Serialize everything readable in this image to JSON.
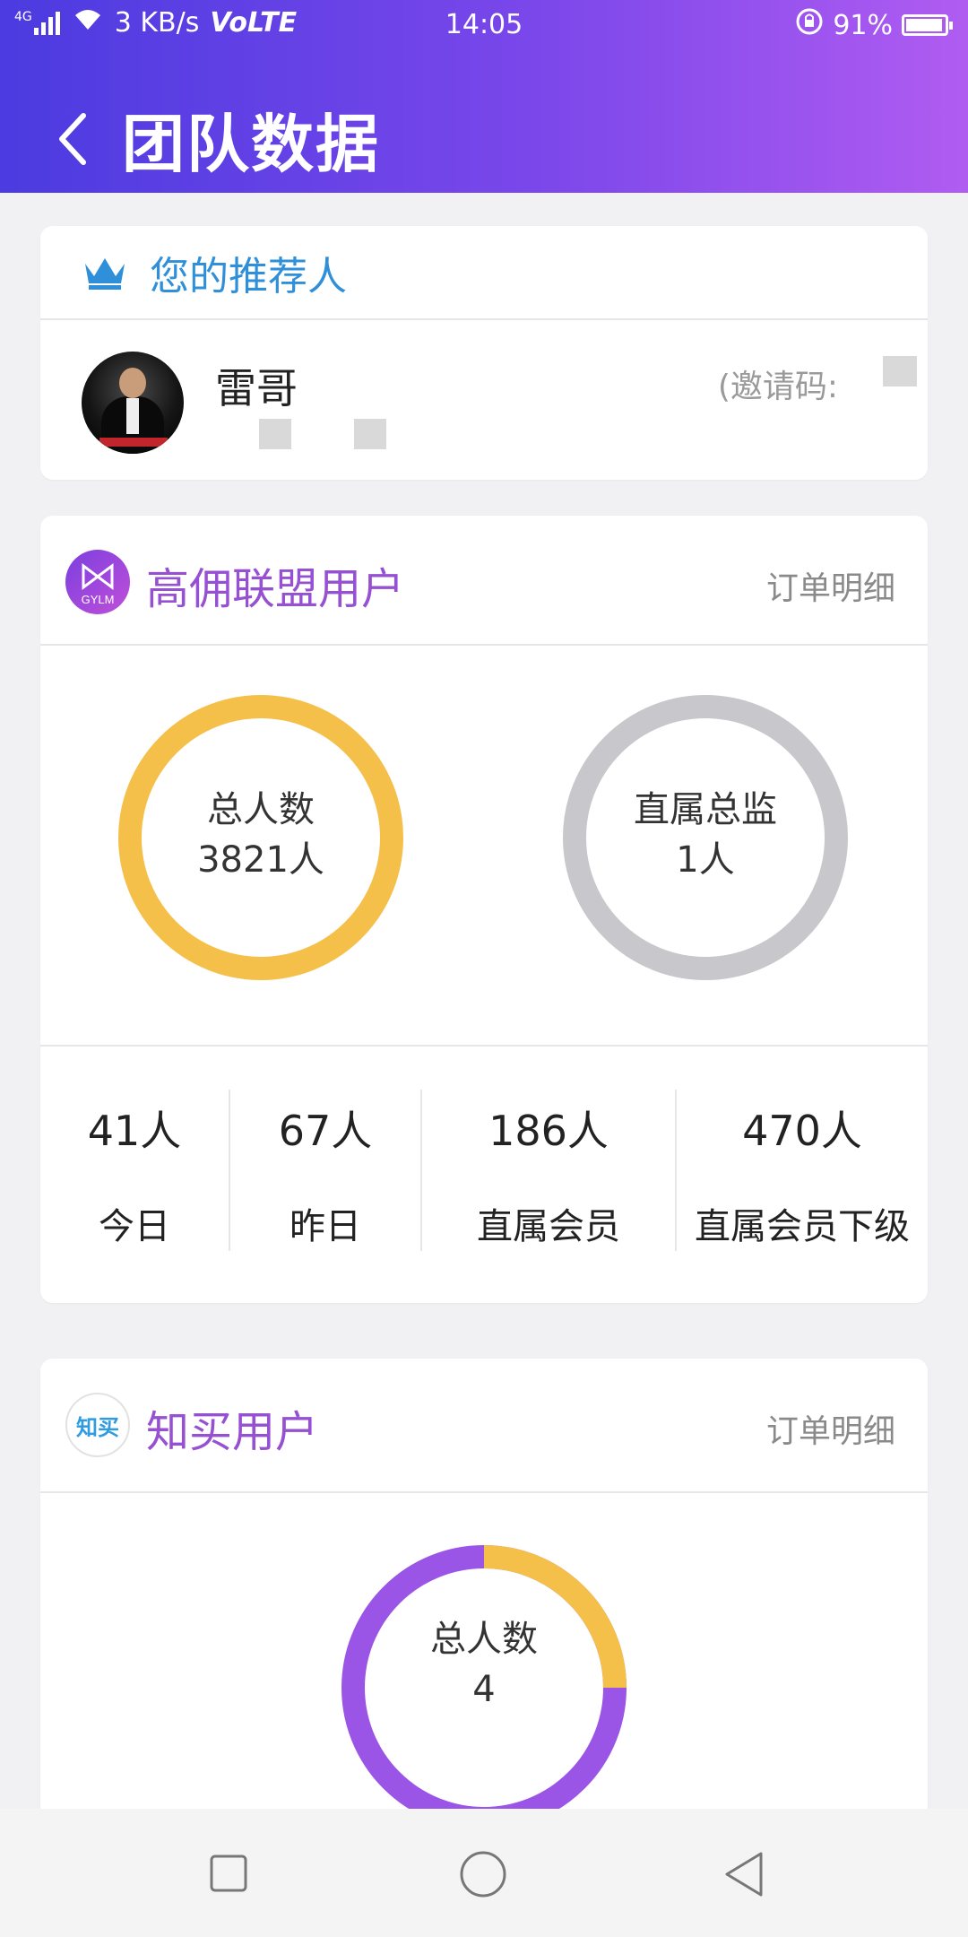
{
  "status_bar": {
    "network": "4G",
    "speed": "3 KB/s",
    "volte": "VoLTE",
    "time": "14:05",
    "battery": "91%"
  },
  "nav": {
    "title": "团队数据"
  },
  "recommender": {
    "section_title": "您的推荐人",
    "name": "雷哥",
    "invite_label": "(邀请码:"
  },
  "gylm": {
    "logo_text": "GYLM",
    "title": "高佣联盟用户",
    "order_link": "订单明细",
    "rings": [
      {
        "label": "总人数",
        "value": "3821人",
        "color": "#f5c04a"
      },
      {
        "label": "直属总监",
        "value": "1人",
        "color": "#c8c8cc"
      }
    ],
    "stats": [
      {
        "value": "41人",
        "label": "今日"
      },
      {
        "value": "67人",
        "label": "昨日"
      },
      {
        "value": "186人",
        "label": "直属会员"
      },
      {
        "value": "470人",
        "label": "直属会员下级"
      }
    ]
  },
  "zhimai": {
    "logo_text": "知买",
    "title": "知买用户",
    "order_link": "订单明细",
    "ring": {
      "label": "总人数",
      "value": "4",
      "primary_color": "#9b55e6",
      "secondary_color": "#f5c04a"
    }
  },
  "bottom_nav": {
    "icons": [
      "recent-apps-icon",
      "home-icon",
      "back-icon"
    ]
  }
}
